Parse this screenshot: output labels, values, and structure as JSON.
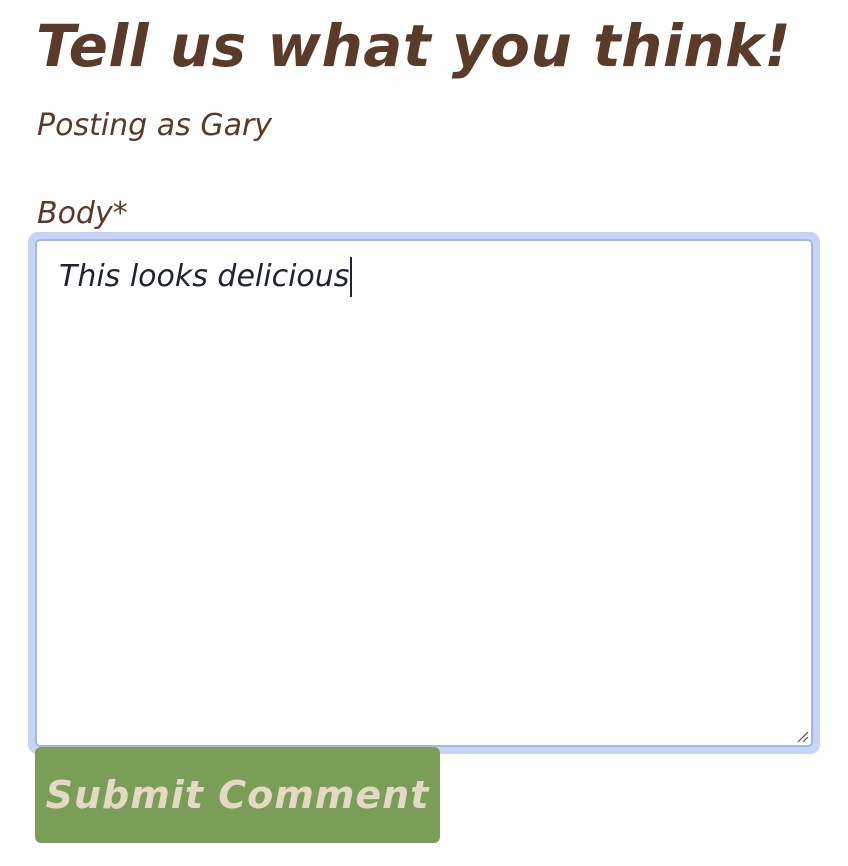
{
  "form": {
    "heading": "Tell us what you think!",
    "posting_as": "Posting as Gary",
    "body_label": "Body*",
    "body_value": "This looks delicious",
    "submit_label": "Submit Comment"
  },
  "colors": {
    "text_brown": "#5a3a28",
    "button_green": "#7a9e58",
    "button_text": "#e3d9c5",
    "focus_ring": "#c6d5f6"
  }
}
